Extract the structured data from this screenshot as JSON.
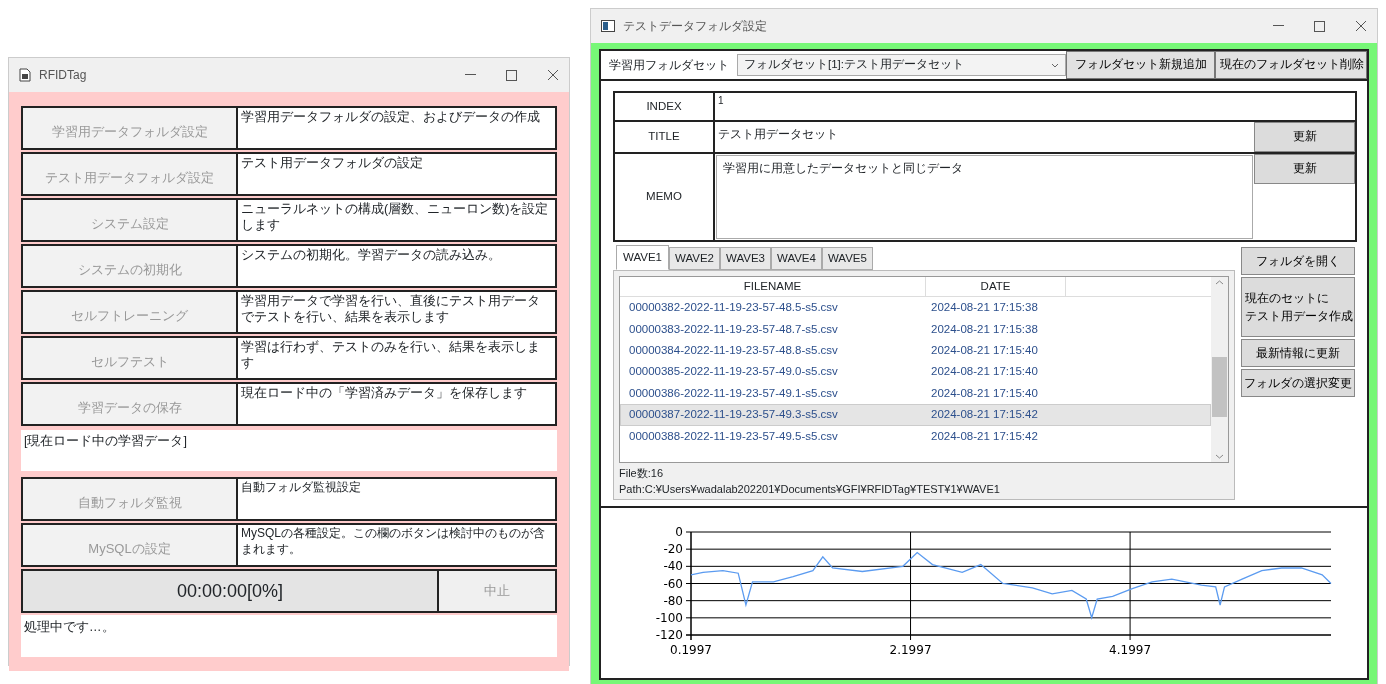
{
  "left_window": {
    "title": "RFIDTag",
    "menu_items": [
      {
        "button": "学習用データフォルダ設定",
        "description": "学習用データフォルダの設定、およびデータの作成",
        "disabled": true
      },
      {
        "button": "テスト用データフォルダ設定",
        "description": "テスト用データフォルダの設定",
        "disabled": true
      },
      {
        "button": "システム設定",
        "description": "ニューラルネットの構成(層数、ニューロン数)を設定します",
        "disabled": true
      },
      {
        "button": "システムの初期化",
        "description": "システムの初期化。学習データの読み込み。",
        "disabled": true
      },
      {
        "button": "セルフトレーニング",
        "description": "学習用データで学習を行い、直後にテスト用データでテストを行い、結果を表示します",
        "disabled": true
      },
      {
        "button": "セルフテスト",
        "description": "学習は行わず、テストのみを行い、結果を表示します",
        "disabled": true
      },
      {
        "button": "学習データの保存",
        "description": "現在ロード中の「学習済みデータ」を保存します",
        "disabled": true
      }
    ],
    "loaded_data": "[現在ロード中の学習データ]",
    "extra_items": [
      {
        "button": "自動フォルダ監視",
        "description": "自動フォルダ監視設定",
        "disabled": true
      },
      {
        "button": "MySQLの設定",
        "description": "MySQLの各種設定。この欄のボタンは検討中のものが含まれます。",
        "disabled": true
      }
    ],
    "progress": "00:00:00[0%]",
    "stop_button": {
      "label": "中止",
      "disabled": true
    },
    "status": "処理中です…。"
  },
  "right_window": {
    "title": "テストデータフォルダ設定",
    "folder_set_label": "学習用フォルダセット",
    "folder_set_value": "フォルダセット[1]:テスト用データセット",
    "top_buttons": [
      "フォルダセット新規追加",
      "現在のフォルダセット削除"
    ],
    "index": {
      "label": "INDEX",
      "value": "1"
    },
    "title_field": {
      "label": "TITLE",
      "value": "テスト用データセット",
      "button": "更新"
    },
    "memo": {
      "label": "MEMO",
      "value": "学習用に用意したデータセットと同じデータ",
      "button": "更新"
    },
    "tabs": [
      {
        "label": "WAVE1",
        "selected": true
      },
      {
        "label": "WAVE2",
        "selected": false
      },
      {
        "label": "WAVE3",
        "selected": false
      },
      {
        "label": "WAVE4",
        "selected": false
      },
      {
        "label": "WAVE5",
        "selected": false
      }
    ],
    "table": {
      "columns": [
        "FILENAME",
        "DATE"
      ],
      "rows": [
        {
          "filename": "00000382-2022-11-19-23-57-48.5-s5.csv",
          "date": "2024-08-21 17:15:38",
          "selected": false
        },
        {
          "filename": "00000383-2022-11-19-23-57-48.7-s5.csv",
          "date": "2024-08-21 17:15:38",
          "selected": false
        },
        {
          "filename": "00000384-2022-11-19-23-57-48.8-s5.csv",
          "date": "2024-08-21 17:15:40",
          "selected": false
        },
        {
          "filename": "00000385-2022-11-19-23-57-49.0-s5.csv",
          "date": "2024-08-21 17:15:40",
          "selected": false
        },
        {
          "filename": "00000386-2022-11-19-23-57-49.1-s5.csv",
          "date": "2024-08-21 17:15:40",
          "selected": false
        },
        {
          "filename": "00000387-2022-11-19-23-57-49.3-s5.csv",
          "date": "2024-08-21 17:15:42",
          "selected": true
        },
        {
          "filename": "00000388-2022-11-19-23-57-49.5-s5.csv",
          "date": "2024-08-21 17:15:42",
          "selected": false
        }
      ]
    },
    "file_count": "File数:16",
    "path": "Path:C:¥Users¥wadalab202201¥Documents¥GFI¥RFIDTag¥TEST¥1¥WAVE1",
    "side_buttons": [
      {
        "lines": [
          "フォルダを開く"
        ]
      },
      {
        "lines": [
          "現在のセットに",
          "テスト用データ作成"
        ]
      },
      {
        "lines": [
          "最新情報に更新"
        ]
      },
      {
        "lines": [
          "フォルダの選択変更"
        ]
      }
    ],
    "chart_data": {
      "type": "line",
      "grid": true,
      "x": [
        0.2,
        0.31,
        0.49,
        0.63,
        0.7,
        0.76,
        0.95,
        1.13,
        1.31,
        1.4,
        1.49,
        1.76,
        2.13,
        2.26,
        2.4,
        2.67,
        2.84,
        3.04,
        3.31,
        3.49,
        3.67,
        3.8,
        3.85,
        3.9,
        4.04,
        4.22,
        4.4,
        4.58,
        4.85,
        4.98,
        5.02,
        5.06,
        5.22,
        5.4,
        5.58,
        5.76,
        5.95,
        6.03
      ],
      "series": [
        {
          "color": "#5b9bf0",
          "values": [
            -50,
            -47,
            -45,
            -48,
            -85,
            -58,
            -58,
            -52,
            -45,
            -29,
            -42,
            -46,
            -40,
            -24,
            -38,
            -47,
            -38,
            -60,
            -65,
            -72,
            -68,
            -78,
            -100,
            -78,
            -75,
            -66,
            -58,
            -55,
            -62,
            -64,
            -85,
            -64,
            -55,
            -45,
            -42,
            -42,
            -50,
            -60
          ]
        }
      ],
      "xlim": [
        0.1997,
        6.03
      ],
      "ylim": [
        -120,
        0
      ],
      "xticks": [
        {
          "value": 0.1997,
          "label": "0.1997"
        },
        {
          "value": 2.1997,
          "label": "2.1997"
        },
        {
          "value": 4.1997,
          "label": "4.1997"
        }
      ],
      "yticks": [
        0,
        -20,
        -40,
        -60,
        -80,
        -100,
        -120
      ]
    }
  }
}
